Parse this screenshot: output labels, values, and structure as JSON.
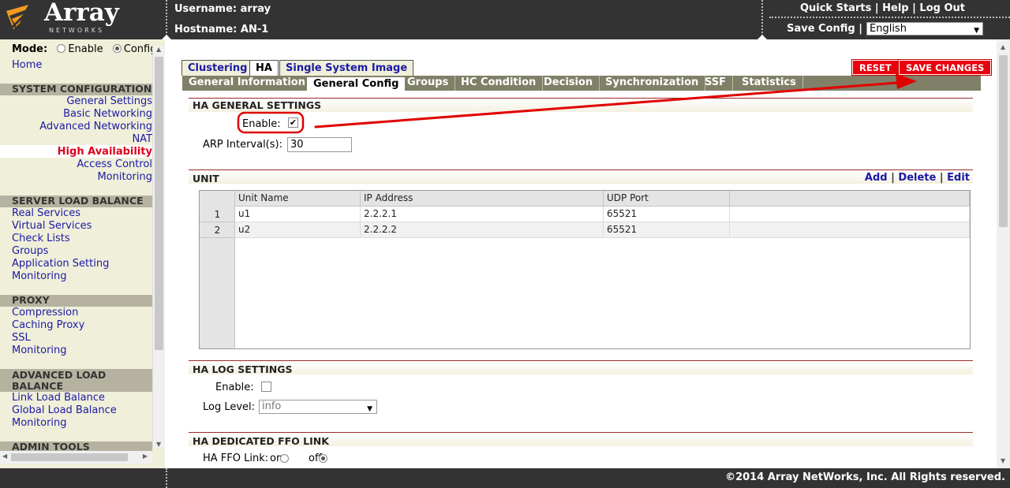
{
  "header": {
    "brand": "Array",
    "brand_sub": "NETWORKS",
    "username": "Username: array",
    "hostname": "Hostname: AN-1",
    "links": [
      "Quick Starts",
      "Help",
      "Log Out"
    ],
    "save_config": "Save Config",
    "language": "English"
  },
  "sidebar": {
    "mode_label": "Mode:",
    "mode_options": [
      "Enable",
      "Config"
    ],
    "mode_selected": "Config",
    "home": "Home",
    "sections": [
      {
        "title": "SYSTEM CONFIGURATION",
        "items": [
          "General Settings",
          "Basic Networking",
          "Advanced Networking",
          "NAT",
          "High Availability",
          "Access Control",
          "Monitoring"
        ]
      },
      {
        "title": "SERVER LOAD BALANCE",
        "items": [
          "Real Services",
          "Virtual Services",
          "Check Lists",
          "Groups",
          "Application Setting",
          "Monitoring"
        ]
      },
      {
        "title": "PROXY",
        "items": [
          "Compression",
          "Caching Proxy",
          "SSL",
          "Monitoring"
        ]
      },
      {
        "title": "ADVANCED LOAD BALANCE",
        "items": [
          "Link Load Balance",
          "Global Load Balance",
          "Monitoring"
        ]
      },
      {
        "title": "ADMIN TOOLS",
        "items": []
      }
    ],
    "active_item": "High Availability"
  },
  "main": {
    "top_tabs": [
      "Clustering",
      "HA",
      "Single System Image"
    ],
    "active_top_tab": "HA",
    "sub_tabs": [
      "General Information",
      "General Config",
      "Groups",
      "HC Condition",
      "Decision",
      "Synchronization",
      "SSF",
      "Statistics"
    ],
    "active_sub_tab": "General Config",
    "buttons": {
      "reset": "RESET",
      "save": "SAVE CHANGES"
    },
    "ha_general": {
      "title": "HA GENERAL SETTINGS",
      "enable_label": "Enable:",
      "enable_checked": true,
      "arp_label": "ARP Interval(s):",
      "arp_value": "30"
    },
    "unit": {
      "title": "UNIT",
      "actions": [
        "Add",
        "Delete",
        "Edit"
      ],
      "columns": [
        "Unit Name",
        "IP Address",
        "UDP Port"
      ],
      "rows": [
        {
          "num": "1",
          "name": "u1",
          "ip": "2.2.2.1",
          "port": "65521"
        },
        {
          "num": "2",
          "name": "u2",
          "ip": "2.2.2.2",
          "port": "65521"
        }
      ]
    },
    "ha_log": {
      "title": "HA LOG SETTINGS",
      "enable_label": "Enable:",
      "enable_checked": false,
      "level_label": "Log Level:",
      "level_value": "info"
    },
    "ffo": {
      "title": "HA DEDICATED FFO LINK",
      "link_label": "HA FFO Link:",
      "options": [
        "on",
        "off"
      ],
      "selected": "off"
    }
  },
  "footer": {
    "copyright": "©2014 Array NetWorks, Inc. All Rights reserved."
  },
  "colors": {
    "header_bg": "#333333",
    "sidebar_bg": "#f0efd9",
    "link": "#1a1aa6",
    "active": "#e0001b",
    "button_red": "#e8000d",
    "annotation": "#e00000"
  }
}
